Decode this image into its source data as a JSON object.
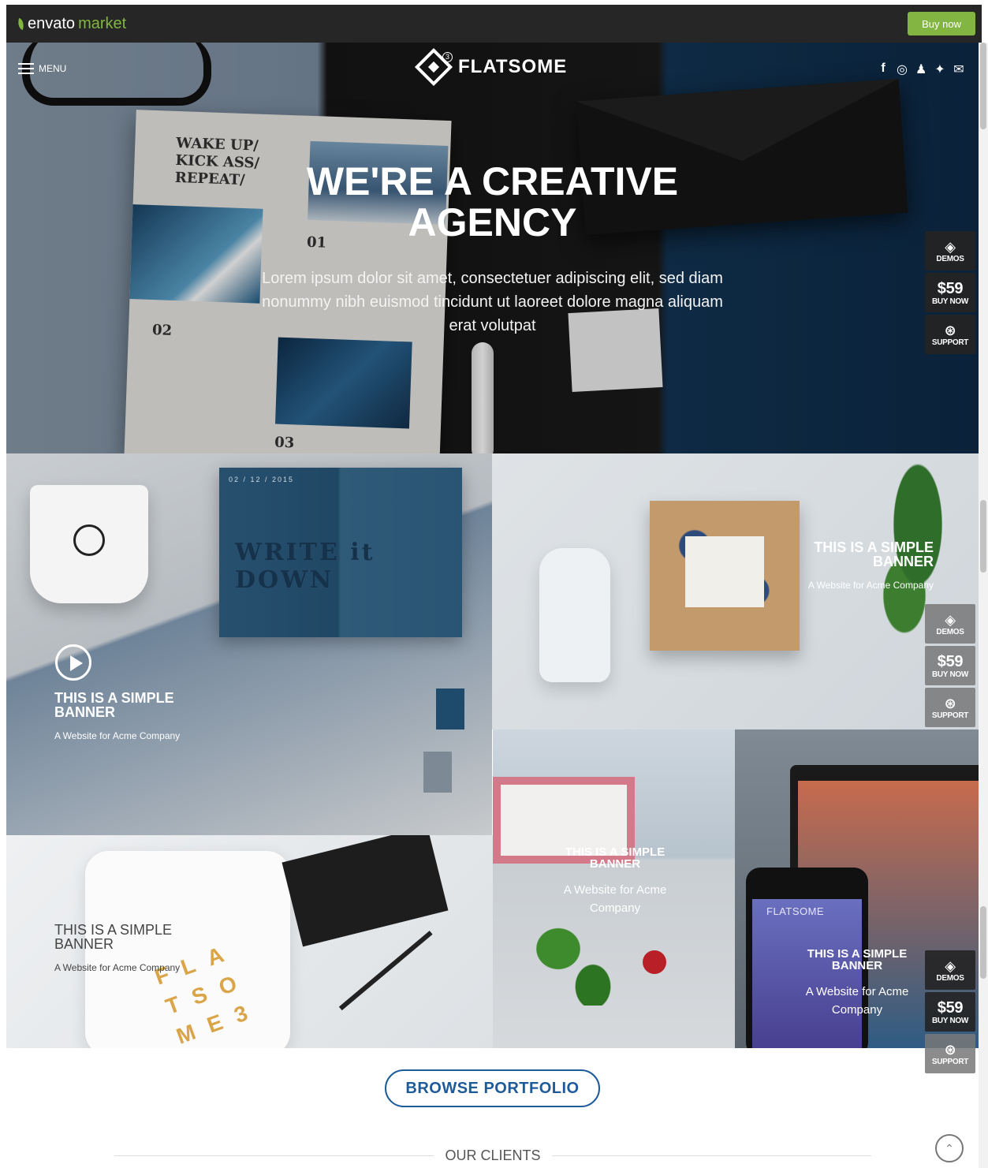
{
  "envato": {
    "logo_main": "envato",
    "logo_accent": "market",
    "buy_label": "Buy now"
  },
  "header": {
    "menu_label": "MENU",
    "brand": "FLATSOME",
    "brand_version": "3"
  },
  "socials": [
    "facebook-icon",
    "instagram-icon",
    "snapchat-icon",
    "twitter-icon",
    "envelope-icon"
  ],
  "hero": {
    "title": "WE'RE A CREATIVE AGENCY",
    "subtitle": "Lorem ipsum dolor sit amet, consectetuer adipiscing elit, sed diam nonummy nibh euismod tincidunt ut laoreet dolore magna aliquam erat volutpat",
    "paper_heading": "WAKE UP/ KICK ASS/ REPEAT/",
    "paper_nums": [
      "01",
      "02",
      "03"
    ]
  },
  "side_buttons": {
    "demos": "DEMOS",
    "price": "$59",
    "buy": "BUY NOW",
    "support": "SUPPORT"
  },
  "banners": [
    {
      "title": "THIS IS A SIMPLE BANNER",
      "subtitle": "A Website for Acme Company",
      "book_text": "WRITE it DOWN",
      "book_date": "02 / 12 / 2015"
    },
    {
      "title": "THIS IS A SIMPLE BANNER",
      "subtitle": "A Website for Acme Company"
    },
    {
      "title": "THIS IS A SIMPLE BANNER",
      "subtitle": "A Website for Acme Company"
    },
    {
      "title": "THIS IS A SIMPLE BANNER",
      "subtitle": "A Website for Acme Company"
    },
    {
      "title": "THIS IS A SIMPLE BANNER",
      "subtitle": "A Website for Acme Company",
      "phone_brand": "FLATSOME"
    }
  ],
  "portfolio": {
    "browse_label": "BROWSE PORTFOLIO"
  },
  "clients": {
    "label": "OUR CLIENTS"
  },
  "colors": {
    "envato_green": "#82b541",
    "link_blue": "#1e5b9a"
  }
}
